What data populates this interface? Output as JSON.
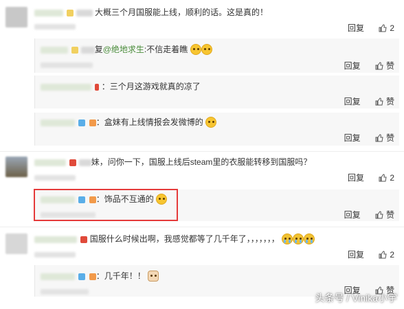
{
  "comments": [
    {
      "text": "大概三个月国服能上线，顺利的话。这是真的！",
      "reply_label": "回复",
      "like_count": "2"
    },
    {
      "mention": "@绝地求生",
      "text": ":不信走着瞧",
      "reply_label": "回复",
      "like_label": "赞"
    },
    {
      "text": "：三个月这游戏就真的凉了",
      "reply_label": "回复",
      "like_label": "赞"
    },
    {
      "text": "：盒妹有上线情报会发微博的",
      "reply_label": "回复",
      "like_label": "赞"
    },
    {
      "text": "，问你一下，国服上线后steam里的衣服能转移到国服吗？",
      "reply_label": "回复",
      "like_count": "2"
    },
    {
      "text": "：饰品不互通的",
      "reply_label": "回复",
      "like_label": "赞"
    },
    {
      "text": "国服什么时候出啊，我感觉都等了几千年了，，，，，，，",
      "reply_label": "回复",
      "like_count": "2"
    },
    {
      "text": "：几千年！！",
      "reply_label": "回复",
      "like_label": "赞"
    }
  ],
  "watermark": "头条号 / Vinika小宇",
  "colors": {
    "highlight": "#e53a3a",
    "mention": "#4a8c3a"
  }
}
